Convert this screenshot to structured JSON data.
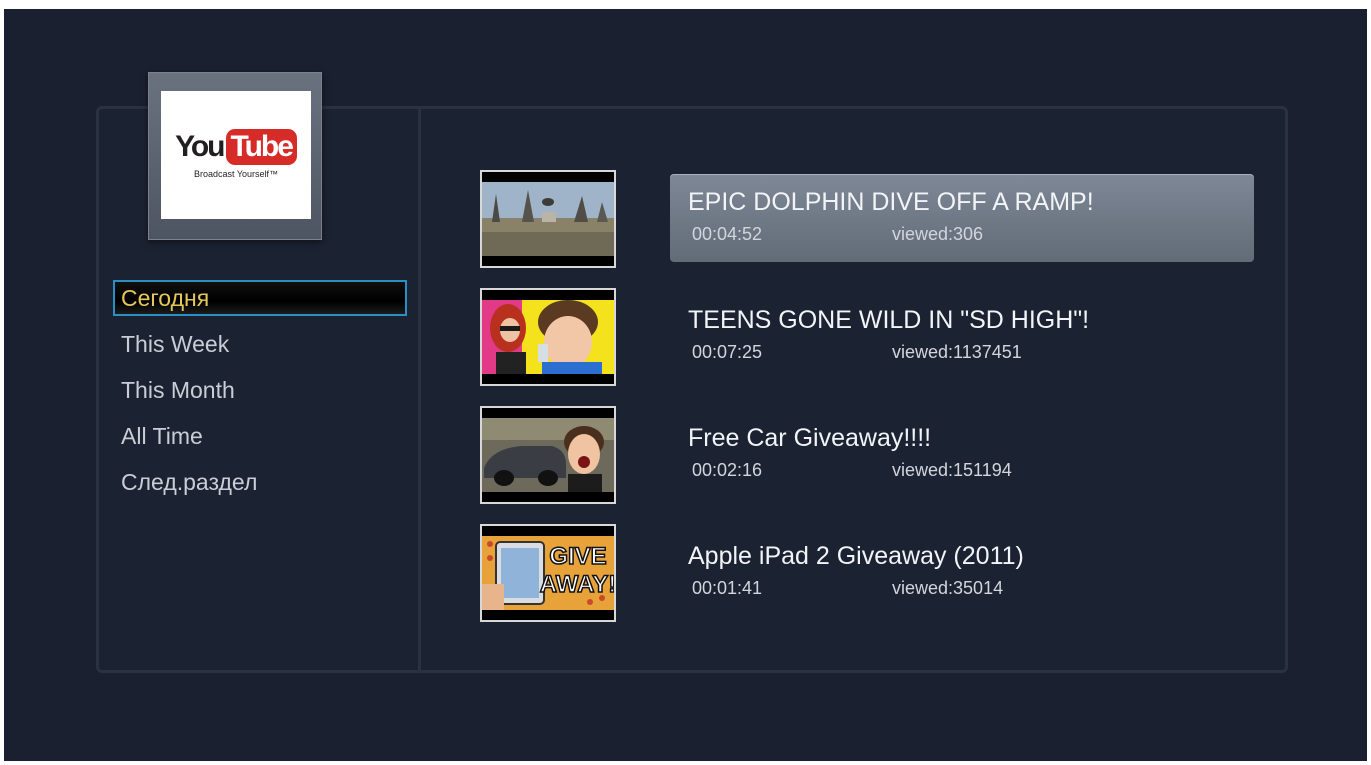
{
  "logo": {
    "word_left": "You",
    "word_right": "Tube",
    "tagline": "Broadcast Yourself™"
  },
  "menu": {
    "items": [
      {
        "label": "Сегодня",
        "selected": true
      },
      {
        "label": "This Week",
        "selected": false
      },
      {
        "label": "This Month",
        "selected": false
      },
      {
        "label": "All Time",
        "selected": false
      },
      {
        "label": "След.раздел",
        "selected": false
      }
    ]
  },
  "videos": [
    {
      "title": "EPIC DOLPHIN DIVE OFF A RAMP!",
      "duration": "00:04:52",
      "views": "viewed:306",
      "selected": true,
      "thumb": "outdoor-park-scene"
    },
    {
      "title": "TEENS GONE WILD IN \"SD HIGH\"!",
      "duration": "00:07:25",
      "views": "viewed:1137451",
      "selected": false,
      "thumb": "two-people-yellow-background"
    },
    {
      "title": "Free Car Giveaway!!!!",
      "duration": "00:02:16",
      "views": "viewed:151194",
      "selected": false,
      "thumb": "car-and-person"
    },
    {
      "title": "Apple iPad 2 Giveaway (2011)",
      "duration": "00:01:41",
      "views": "viewed:35014",
      "selected": false,
      "thumb": "give-away-ipad"
    }
  ],
  "thumb_text": {
    "give_line1": "GIVE",
    "give_line2": "AWAY!"
  },
  "colors": {
    "background": "#1a2030",
    "selection_text": "#e6c85a",
    "selection_border": "#2c8fc4",
    "youtube_red": "#d62b27"
  }
}
